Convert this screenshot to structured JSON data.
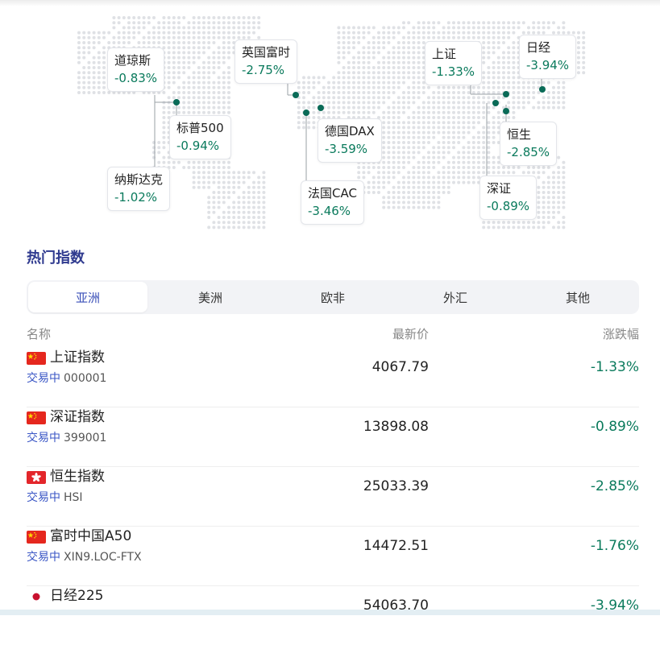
{
  "map": {
    "cards": [
      {
        "id": "dow",
        "name": "道琼斯",
        "pct": "-0.83%"
      },
      {
        "id": "sp500",
        "name": "标普500",
        "pct": "-0.94%"
      },
      {
        "id": "nasdaq",
        "name": "纳斯达克",
        "pct": "-1.02%"
      },
      {
        "id": "ftse",
        "name": "英国富时",
        "pct": "-2.75%"
      },
      {
        "id": "dax",
        "name": "德国DAX",
        "pct": "-3.59%"
      },
      {
        "id": "cac",
        "name": "法国CAC",
        "pct": "-3.46%"
      },
      {
        "id": "shanghai",
        "name": "上证",
        "pct": "-1.33%"
      },
      {
        "id": "nikkei",
        "name": "日经",
        "pct": "-3.94%"
      },
      {
        "id": "hangseng",
        "name": "恒生",
        "pct": "-2.85%"
      },
      {
        "id": "shenzhen",
        "name": "深证",
        "pct": "-0.89%"
      }
    ],
    "marker_color": "#0a6b57",
    "negative_color": "#0a7a5c"
  },
  "section": {
    "title": "热门指数"
  },
  "tabs": [
    {
      "label": "亚洲",
      "active": true
    },
    {
      "label": "美洲",
      "active": false
    },
    {
      "label": "欧非",
      "active": false
    },
    {
      "label": "外汇",
      "active": false
    },
    {
      "label": "其他",
      "active": false
    }
  ],
  "table": {
    "headers": {
      "name": "名称",
      "price": "最新价",
      "change": "涨跌幅"
    },
    "rows": [
      {
        "flag": "cn",
        "name": "上证指数",
        "status": "交易中",
        "code": "000001",
        "price": "4067.79",
        "change": "-1.33%"
      },
      {
        "flag": "cn",
        "name": "深证指数",
        "status": "交易中",
        "code": "399001",
        "price": "13898.08",
        "change": "-0.89%"
      },
      {
        "flag": "hk",
        "name": "恒生指数",
        "status": "交易中",
        "code": "HSI",
        "price": "25033.39",
        "change": "-2.85%"
      },
      {
        "flag": "cn",
        "name": "富时中国A50",
        "status": "交易中",
        "code": "XIN9.LOC-FTX",
        "price": "14472.51",
        "change": "-1.76%"
      },
      {
        "flag": "jp",
        "name": "日经225",
        "status": "",
        "code": "",
        "price": "54063.70",
        "change": "-3.94%"
      }
    ]
  }
}
